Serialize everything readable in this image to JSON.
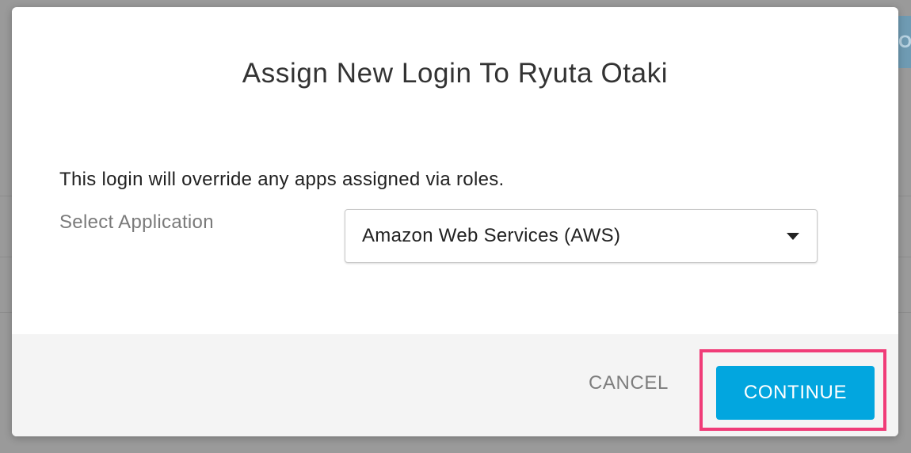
{
  "background": {
    "edge_chip_text": "O"
  },
  "dialog": {
    "title": "Assign New Login To Ryuta Otaki",
    "notice": "This login will override any apps assigned via roles.",
    "select_application": {
      "label": "Select Application",
      "selected_value": "Amazon Web Services (AWS)",
      "caret_icon": "caret-down-icon"
    },
    "footer": {
      "cancel_label": "CANCEL",
      "continue_label": "CONTINUE"
    }
  },
  "colors": {
    "primary_button": "#02a6df",
    "highlight_frame": "#f03c78",
    "footer_background": "#f4f4f4"
  }
}
